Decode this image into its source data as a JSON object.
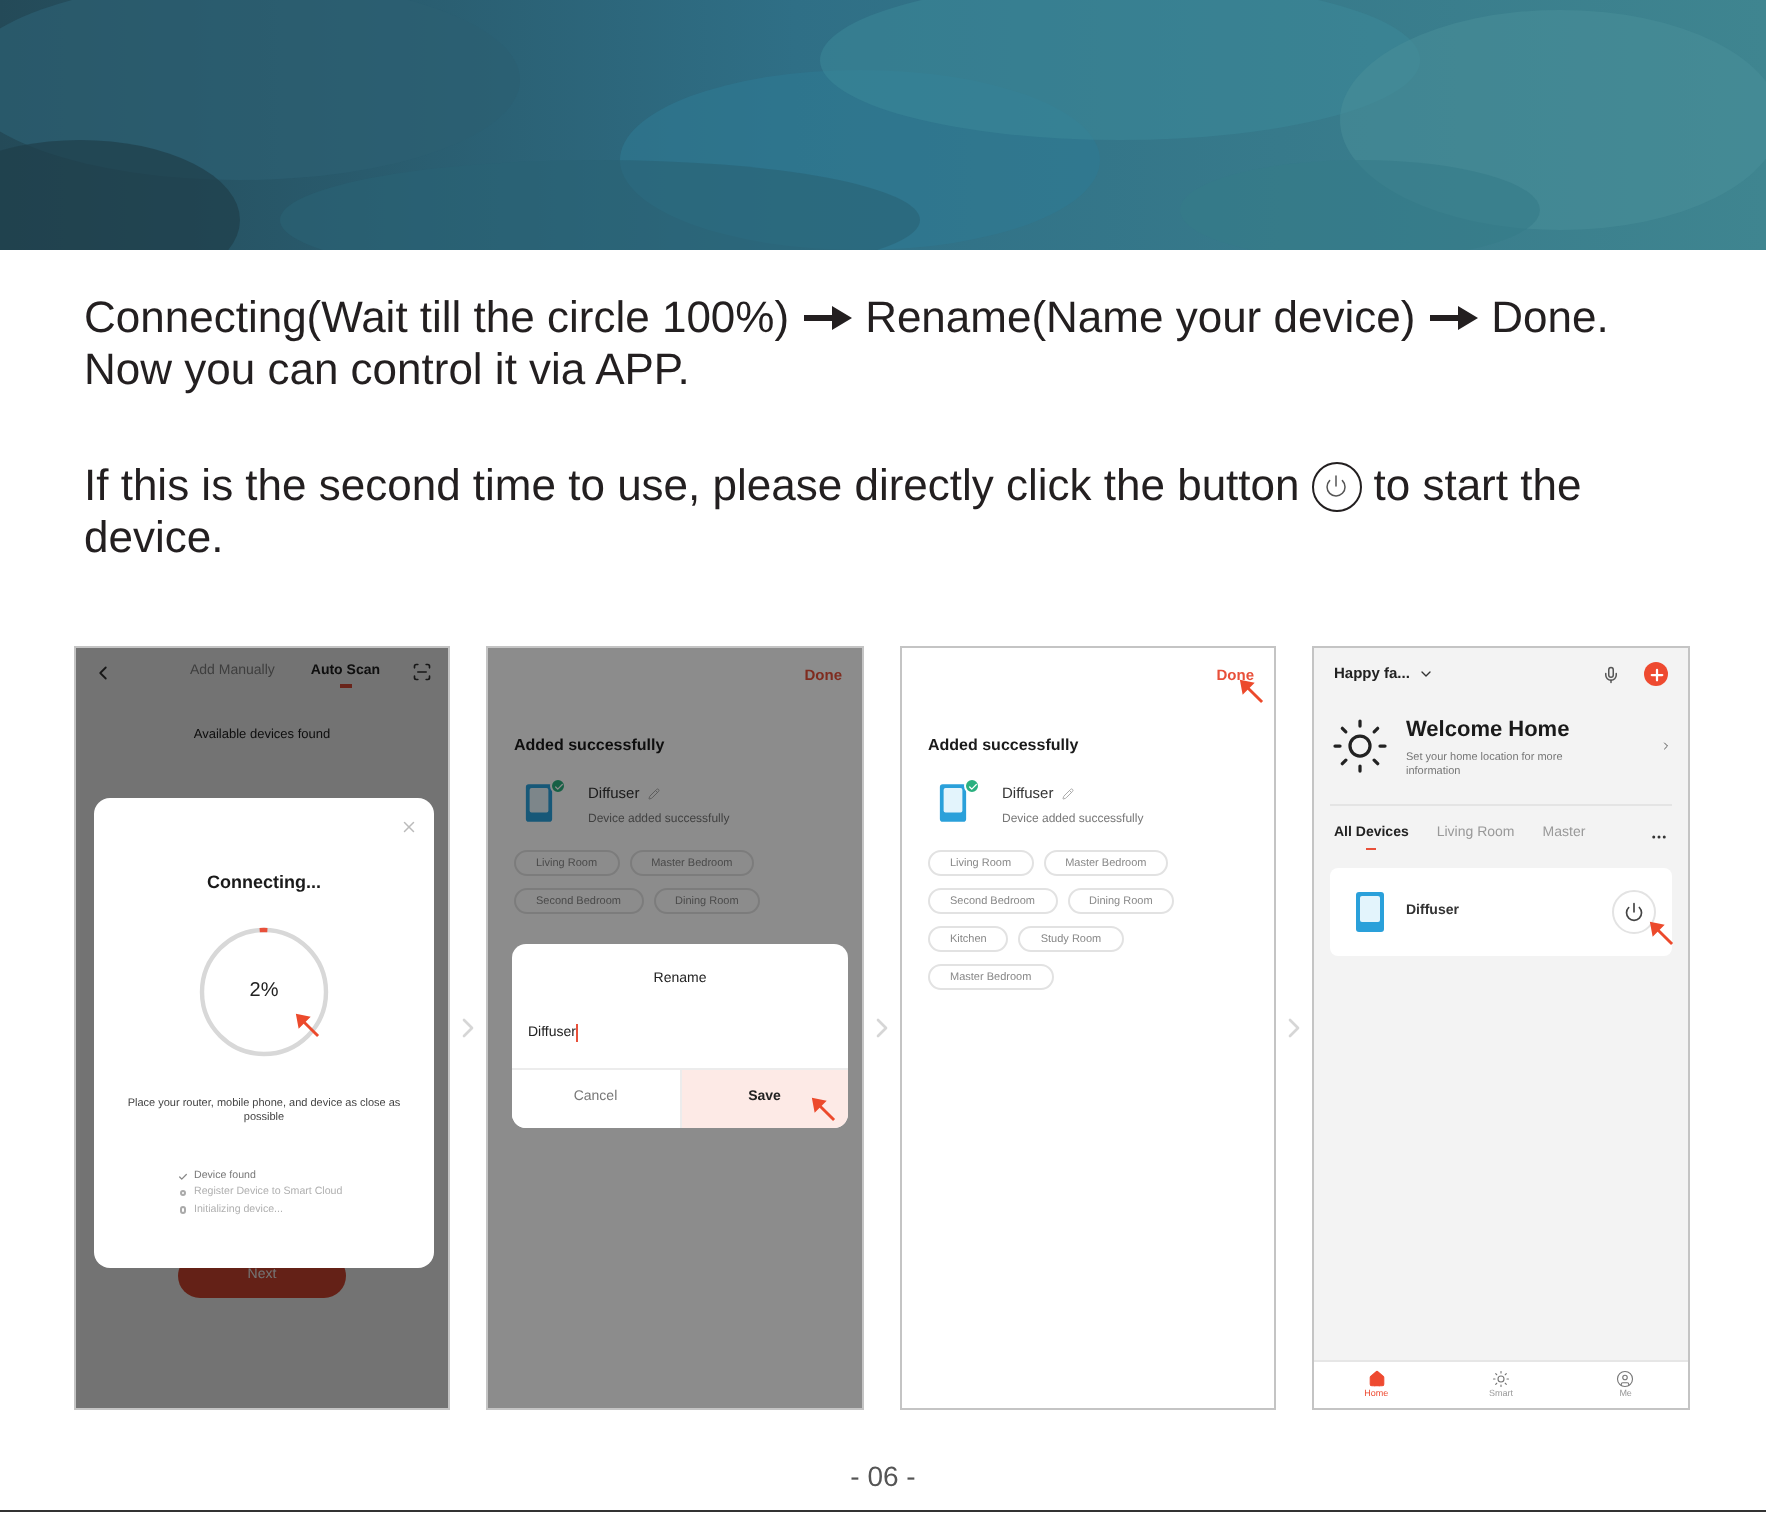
{
  "header": {
    "kind": "picture"
  },
  "steps": [
    "Connecting(Wait till the circle 100%)",
    "Rename(Name your device)",
    "Done."
  ],
  "steps_note": "Now you can control it via APP.",
  "restart_hint": {
    "before": "If this is the second time to use, please directly click the button",
    "after": "to start the",
    "continued": "device."
  },
  "screens": [
    {
      "kind": "connecting",
      "dimmed": true,
      "tabs": [
        {
          "label": "Add Manually",
          "selected": false
        },
        {
          "label": "Auto Scan",
          "selected": true
        }
      ],
      "subtitle": "Available devices found",
      "dialog": {
        "title": "Connecting...",
        "level": 0.02,
        "progress": "2%",
        "hint": "Place your router, mobile phone, and device as close as possible",
        "checklist": [
          {
            "label": "Device found",
            "done": true
          },
          {
            "label": "Register Device to Smart Cloud",
            "done": false
          },
          {
            "label": "Initializing device...",
            "done": false
          }
        ]
      },
      "next_button": "Next"
    },
    {
      "kind": "added",
      "dimmed": true,
      "done": "Done",
      "title": "Added successfully",
      "device": {
        "name": "Diffuser",
        "status": "Device added successfully"
      },
      "rooms": [
        "Living Room",
        "Master Bedroom",
        "Second Bedroom",
        "Dining Room"
      ],
      "dialog": {
        "title": "Rename",
        "value": "Diffuser",
        "buttons": [
          {
            "label": "Cancel",
            "selected": false
          },
          {
            "label": "Save",
            "selected": true
          }
        ]
      }
    },
    {
      "kind": "added",
      "dimmed": false,
      "done": "Done",
      "title": "Added successfully",
      "device": {
        "name": "Diffuser",
        "status": "Device added successfully"
      },
      "rooms": [
        "Living Room",
        "Master Bedroom",
        "Second Bedroom",
        "Dining Room",
        "Kitchen",
        "Study Room",
        "Master Bedroom"
      ]
    },
    {
      "kind": "home",
      "home_name": "Happy fa...",
      "welcome": "Welcome Home",
      "location_hint": "Set your home location for more information",
      "tabs": [
        {
          "label": "All Devices",
          "selected": true
        },
        {
          "label": "Living Room",
          "selected": false
        },
        {
          "label": "Master",
          "selected": false
        }
      ],
      "devices": [
        {
          "name": "Diffuser"
        }
      ],
      "nav": [
        {
          "label": "Home",
          "selected": true
        },
        {
          "label": "Smart",
          "selected": false
        },
        {
          "label": "Me",
          "selected": false
        }
      ]
    }
  ],
  "page_number": "- 06 -"
}
